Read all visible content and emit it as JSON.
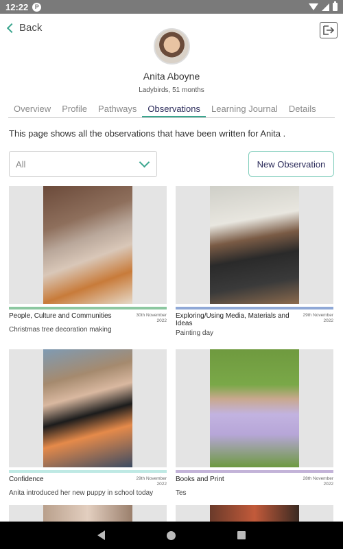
{
  "status_bar": {
    "time": "12:22",
    "app_badge": "P"
  },
  "header": {
    "back_label": "Back"
  },
  "child": {
    "name": "Anita Aboyne",
    "subtitle": "Ladybirds, 51 months"
  },
  "tabs": [
    {
      "label": "Overview"
    },
    {
      "label": "Profile"
    },
    {
      "label": "Pathways"
    },
    {
      "label": "Observations",
      "active": true
    },
    {
      "label": "Learning Journal"
    },
    {
      "label": "Details"
    }
  ],
  "intro_text": "This page shows all the observations that have been written for Anita .",
  "filter": {
    "selected": "All"
  },
  "new_observation_label": "New Observation",
  "observations": [
    {
      "area": "People, Culture and Communities",
      "date": "30th November 2022",
      "description": "Christmas tree decoration making",
      "bar_color": "#8cc7a0"
    },
    {
      "area": "Exploring/Using Media, Materials and Ideas",
      "date": "29th November 2022",
      "description": "Painting day",
      "bar_color": "#8fa8d6"
    },
    {
      "area": "Confidence",
      "date": "29th November 2022",
      "description": "Anita introduced her new puppy in school today",
      "bar_color": "#bfe9e4"
    },
    {
      "area": "Books and Print",
      "date": "28th November 2022",
      "description": "Tes",
      "bar_color": "#c3b3d8"
    }
  ],
  "colors": {
    "accent": "#3aa58e",
    "active_tab_text": "#2b2b5a"
  }
}
